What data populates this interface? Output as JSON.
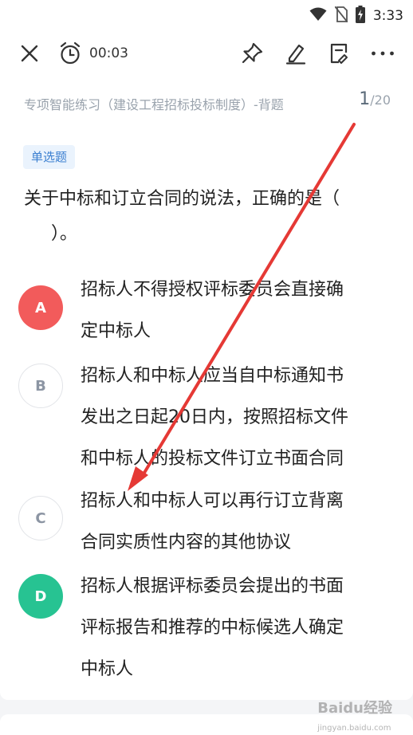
{
  "status_bar": {
    "time": "3:33",
    "icons": [
      "wifi-icon",
      "no-sim-icon",
      "battery-charging-icon"
    ]
  },
  "toolbar": {
    "timer": "00:03",
    "icons": [
      "close-icon",
      "alarm-clock-icon",
      "pin-icon",
      "edit-icon",
      "answer-sheet-icon",
      "more-icon"
    ]
  },
  "subheader": {
    "title": "专项智能练习（建设工程招标投标制度）-背题",
    "current": "1",
    "total": "/20"
  },
  "question": {
    "type": "单选题",
    "text": "关于中标和订立合同的说法，正确的是（",
    "text_end": "）。"
  },
  "options": [
    {
      "letter": "A",
      "lines": [
        "招标人不得授权评标委员会直接确",
        "定中标人"
      ],
      "state": "wrong"
    },
    {
      "letter": "B",
      "lines": [
        "招标人和中标人应当自中标通知书",
        "发出之日起20日内，按照招标文件",
        "和中标人的投标文件订立书面合同"
      ],
      "state": "normal"
    },
    {
      "letter": "C",
      "lines": [
        "招标人和中标人可以再行订立背离",
        "合同实质性内容的其他协议"
      ],
      "state": "normal"
    },
    {
      "letter": "D",
      "lines": [
        "招标人根据评标委员会提出的书面",
        "评标报告和推荐的中标候选人确定",
        "中标人"
      ],
      "state": "correct"
    }
  ],
  "watermark": {
    "text": "Baidu经验",
    "sub": "jingyan.baidu.com"
  },
  "colors": {
    "wrong": "#f25b5b",
    "correct": "#27c392",
    "accent": "#3b7fd0",
    "arrow": "#e53935"
  }
}
